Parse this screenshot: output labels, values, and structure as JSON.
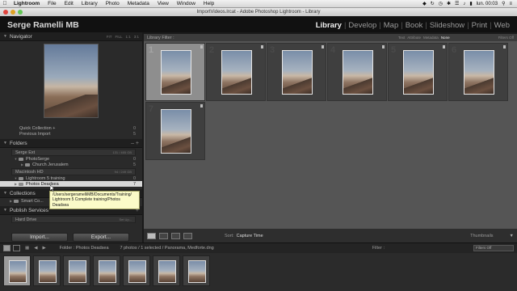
{
  "menubar": {
    "app": "Lightroom",
    "items": [
      "File",
      "Edit",
      "Library",
      "Photo",
      "Metadata",
      "View",
      "Window",
      "Help"
    ],
    "clock": "lun. 00:03"
  },
  "window": {
    "title": "ImportVideos.lrcat - Adobe Photoshop Lightroom - Library"
  },
  "identity_plate": "Serge Ramelli MB",
  "modules": [
    {
      "label": "Library",
      "active": true
    },
    {
      "label": "Develop"
    },
    {
      "label": "Map"
    },
    {
      "label": "Book"
    },
    {
      "label": "Slideshow"
    },
    {
      "label": "Print"
    },
    {
      "label": "Web"
    }
  ],
  "left_panel": {
    "navigator": {
      "title": "Navigator",
      "zoom_options": [
        "FIT",
        "FILL",
        "1:1",
        "3:1"
      ]
    },
    "catalog_rows": [
      {
        "label": "Quick Collection +",
        "count": "0"
      },
      {
        "label": "Previous Import",
        "count": "5"
      }
    ],
    "folders": {
      "title": "Folders",
      "volume1": {
        "label": "Serge Ext",
        "info": "131 / 465 GB"
      },
      "v1_items": [
        {
          "label": "PhotoSerge",
          "count": "0"
        },
        {
          "label": "Church Jerusalem",
          "count": "5"
        }
      ],
      "volume2": {
        "label": "Macintosh HD",
        "info": "94 / 249 GB"
      },
      "v2_items": [
        {
          "label": "Lightroom 5 training",
          "count": "0"
        },
        {
          "label": "Photos Deadsea",
          "count": "7"
        }
      ]
    },
    "collections": {
      "title": "Collections",
      "item": "Smart Co..."
    },
    "publish": {
      "title": "Publish Services",
      "item": "Hard Drive",
      "setup": "Set Up..."
    },
    "tooltip": [
      "/Users/sergeramelliMB/Documents/Training/",
      "Lightroom 5 Complete training/Photos",
      "Deadsea"
    ],
    "import_label": "Import...",
    "export_label": "Export..."
  },
  "library_filter": {
    "title": "Library Filter :",
    "options": [
      "Text",
      "Attribute",
      "Metadata",
      "None"
    ],
    "active": "None",
    "preset": "Filters Off"
  },
  "grid": {
    "count": 7,
    "selected_index": 0
  },
  "toolbar": {
    "sort_label": "Sort:",
    "sort_value": "Capture Time",
    "thumbnails_label": "Thumbnails"
  },
  "filmstrip_bar": {
    "folder_path": "Folder : Photos Deadsea",
    "status": "7 photos / 1 selected / Panorama, Medforte.dng",
    "filter_label": "Filter :",
    "filter_value": "Filters Off"
  },
  "colors": {
    "accent_active": "#f2f2f2",
    "grid_bg": "#555555",
    "tooltip_bg": "#fbfbc8"
  }
}
